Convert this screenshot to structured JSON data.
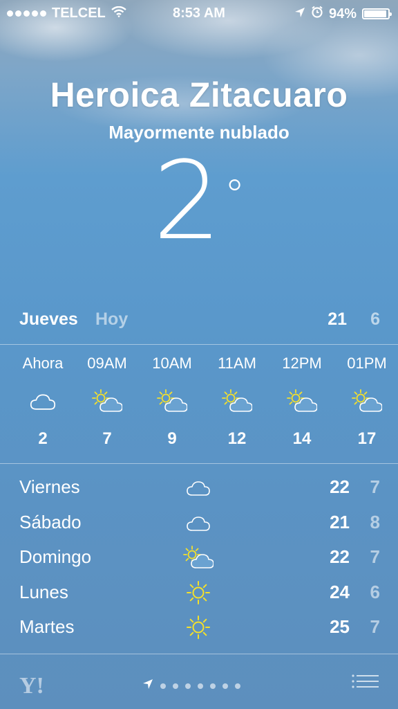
{
  "status_bar": {
    "carrier": "TELCEL",
    "time": "8:53 AM",
    "battery": "94%",
    "battery_level": 0.94,
    "icons": [
      "signal-dots",
      "wifi-icon",
      "location-arrow-icon",
      "alarm-icon",
      "battery-icon"
    ]
  },
  "location": {
    "city": "Heroica Zitacuaro",
    "condition": "Mayormente nublado",
    "temperature": "2",
    "degree_symbol": "°"
  },
  "today": {
    "day": "Jueves",
    "label": "Hoy",
    "high": "21",
    "low": "6"
  },
  "hourly": [
    {
      "time": "Ahora",
      "icon": "cloud-icon",
      "temp": "2"
    },
    {
      "time": "09AM",
      "icon": "partly-sunny-icon",
      "temp": "7"
    },
    {
      "time": "10AM",
      "icon": "partly-sunny-icon",
      "temp": "9"
    },
    {
      "time": "11AM",
      "icon": "partly-sunny-icon",
      "temp": "12"
    },
    {
      "time": "12PM",
      "icon": "partly-sunny-icon",
      "temp": "14"
    },
    {
      "time": "01PM",
      "icon": "partly-sunny-icon",
      "temp": "17"
    }
  ],
  "daily": [
    {
      "day": "Viernes",
      "icon": "cloud-icon",
      "high": "22",
      "low": "7"
    },
    {
      "day": "Sábado",
      "icon": "cloud-icon",
      "high": "21",
      "low": "8"
    },
    {
      "day": "Domingo",
      "icon": "partly-sunny-icon",
      "high": "22",
      "low": "7"
    },
    {
      "day": "Lunes",
      "icon": "sun-icon",
      "high": "24",
      "low": "6"
    },
    {
      "day": "Martes",
      "icon": "sun-icon",
      "high": "25",
      "low": "7"
    }
  ],
  "footer": {
    "yahoo_logo": "Y!",
    "page_count": 7,
    "current_page": 0,
    "icons": [
      "yahoo-logo-icon",
      "location-arrow-icon",
      "list-icon"
    ]
  },
  "colors": {
    "sun_yellow": "#f5e12a",
    "text": "#ffffff",
    "muted_text": "rgba(255,255,255,0.55)"
  }
}
